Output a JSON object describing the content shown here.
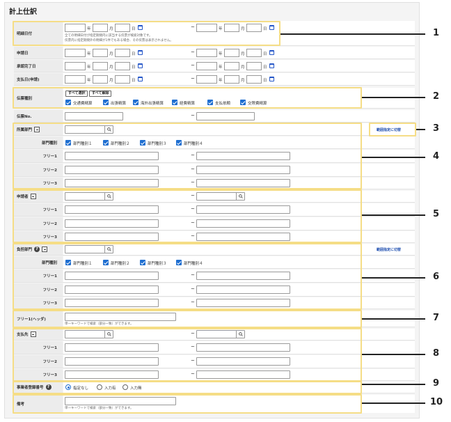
{
  "title": "計上仕訳",
  "units": {
    "year": "年",
    "month": "月",
    "day": "日",
    "tilde": "~"
  },
  "date_rows": {
    "meisai": "明細日付",
    "shinsei": "申請日",
    "shonin": "承認完了日",
    "shiharai": "支払日(申請)"
  },
  "meisai_note_1": "全ての明細日付が指定期間内に該当する伝票が検索対象です。",
  "meisai_note_2": "伝票内に指定期間外の明細が1件でもある場合、その伝票は表示されません。",
  "denpyo_shubetsu": {
    "label": "伝票種別",
    "select_all": "すべて選択",
    "clear_all": "すべて解除",
    "options": [
      "交通費精算",
      "出張精算",
      "海外出張精算",
      "経費精算",
      "支払依頼",
      "交際費精算"
    ]
  },
  "denpyo_no": "伝票No.",
  "shozoku": {
    "label": "所属部門",
    "range_link": "範囲指定に切替"
  },
  "futan": {
    "label": "負担部門",
    "range_link": "範囲指定に切替"
  },
  "bumon_shubetsu": {
    "label": "部門種別",
    "options": [
      "部門種別１",
      "部門種別２",
      "部門種別３",
      "部門種別４"
    ]
  },
  "free": [
    "フリー1",
    "フリー2",
    "フリー3"
  ],
  "shinseisha": "申請者",
  "free_header": {
    "label": "フリー1(ヘッダ)",
    "note": "単一キーワードで検索（部分一致）ができます。"
  },
  "shiharaisaki": "支払先",
  "jigyosha": {
    "label": "事業者登録番号",
    "options": [
      "指定なし",
      "入力有",
      "入力無"
    ]
  },
  "biko": {
    "label": "備考",
    "note": "単一キーワードで検索（部分一致）ができます。"
  },
  "callouts": [
    "1",
    "2",
    "3",
    "4",
    "5",
    "6",
    "7",
    "8",
    "9",
    "10"
  ],
  "colors": {
    "highlight": "#f5dd86",
    "accent": "#1f6fd1",
    "link": "#1f4fb0"
  }
}
